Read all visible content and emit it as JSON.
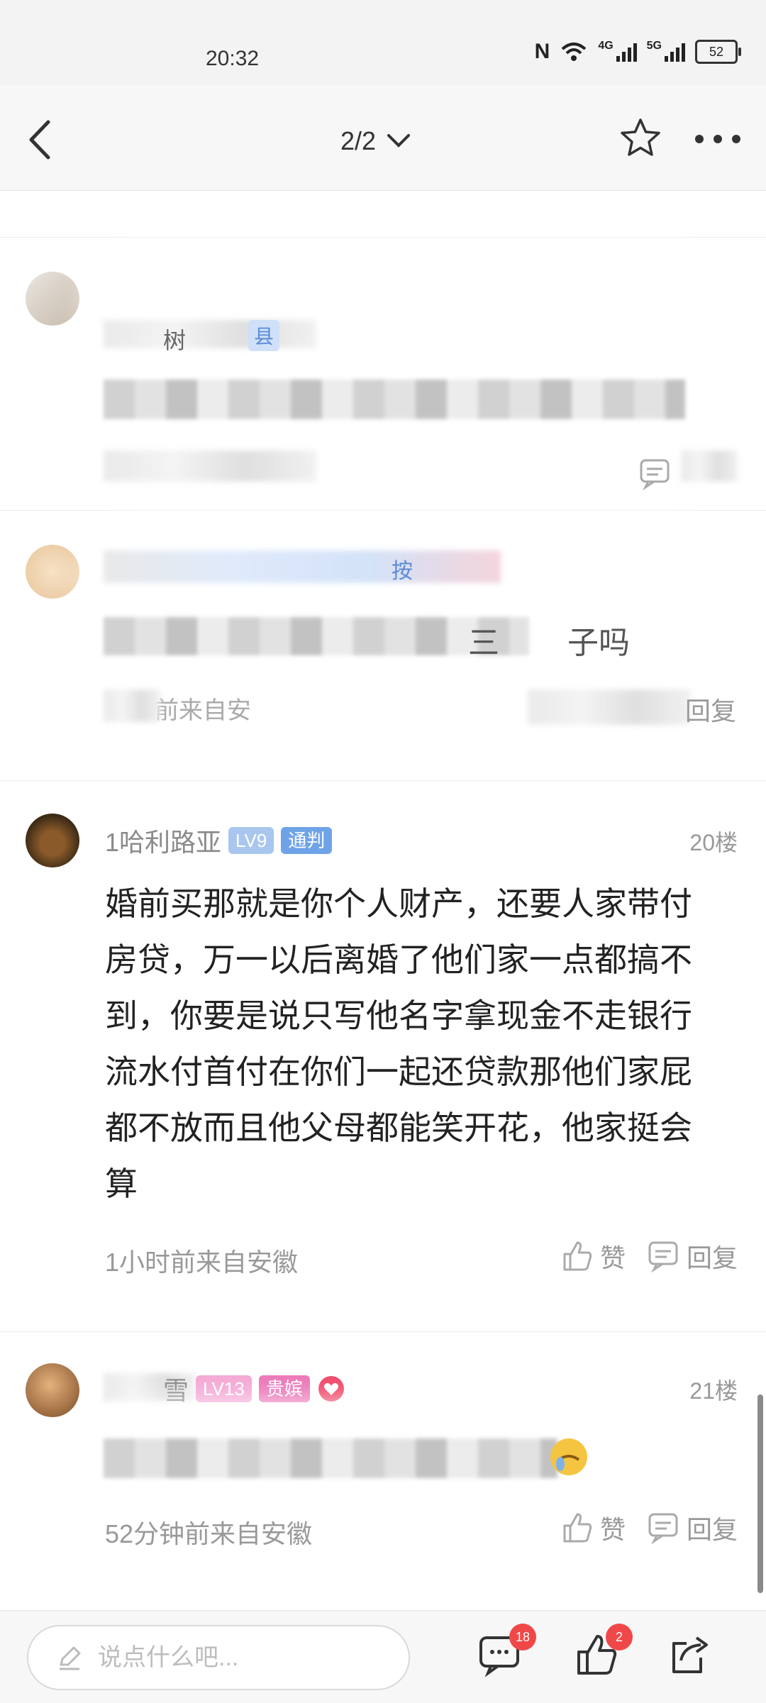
{
  "status_bar": {
    "time": "20:32",
    "net1": "4G",
    "net2": "5G",
    "battery": "52"
  },
  "nav": {
    "page_indicator": "2/2"
  },
  "comments": [
    {
      "username_fragment": "树",
      "badge_fragment": "县"
    },
    {
      "badge_fragment": "按",
      "body_fragment": "三",
      "body_fragment2": "子吗",
      "meta_fragment": "前来自安",
      "reply": "回复"
    },
    {
      "username": "1哈利路亚",
      "level": "LV9",
      "title": "通判",
      "floor": "20楼",
      "body": "婚前买那就是你个人财产，还要人家带付房贷，万一以后离婚了他们家一点都搞不到，你要是说只写他名字拿现金不走银行流水付首付在你们一起还贷款那他们家屁都不放而且他父母都能笑开花，他家挺会算",
      "meta": "1小时前来自安徽",
      "like": "赞",
      "reply": "回复"
    },
    {
      "username_fragment": "雪",
      "level": "LV13",
      "title": "贵嫔",
      "floor": "21楼",
      "meta": "52分钟前来自安徽",
      "like": "赞",
      "reply": "回复"
    }
  ],
  "bottom_bar": {
    "input_placeholder": "说点什么吧...",
    "comment_count": "18",
    "like_count": "2"
  }
}
